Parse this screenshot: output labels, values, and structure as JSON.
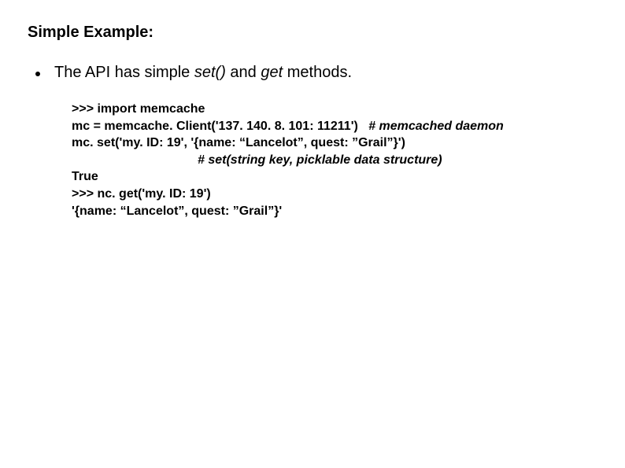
{
  "heading": "Simple Example:",
  "bullet": {
    "pre": "The API has simple ",
    "em1": "set()",
    "mid": " and ",
    "em2": "get",
    "post": " methods."
  },
  "code": {
    "l1": ">>> import memcache",
    "l2a": "mc = memcache. Client('137. 140. 8. 101: 11211')   ",
    "l2b": "# memcached daemon",
    "l3": "mc. set('my. ID: 19', '{name: “Lancelot”, quest: ”Grail”}')",
    "l4": "# set(string key, picklable data structure)",
    "l5": "True",
    "l6": ">>> nc. get('my. ID: 19')",
    "l7": "'{name: “Lancelot”, quest: ”Grail”}'"
  }
}
